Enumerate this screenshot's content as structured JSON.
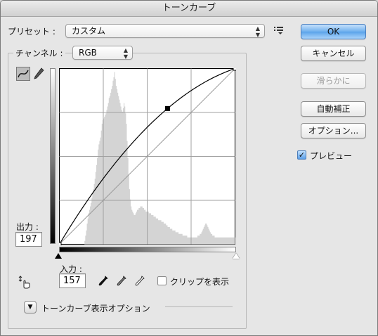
{
  "window": {
    "title": "トーンカーブ"
  },
  "preset": {
    "label": "プリセット :",
    "value": "カスタム",
    "menu_icon": "preset-options-icon"
  },
  "channel": {
    "label": "チャンネル :",
    "value": "RGB"
  },
  "tools": {
    "curve_tool_icon": "curve-point-icon",
    "pencil_tool_icon": "pencil-icon"
  },
  "output": {
    "label": "出力 :",
    "value": "197"
  },
  "input": {
    "label": "入力 :",
    "value": "157"
  },
  "eyedroppers": [
    "black-point-eyedropper-icon",
    "gray-point-eyedropper-icon",
    "white-point-eyedropper-icon"
  ],
  "clipping": {
    "label": "クリップを表示",
    "checked": false
  },
  "curve_display": {
    "label": "トーンカーブ表示オプション"
  },
  "buttons": {
    "ok": "OK",
    "cancel": "キャンセル",
    "smooth": "滑らかに",
    "auto": "自動補正",
    "options": "オプション..."
  },
  "preview": {
    "label": "プレビュー",
    "checked": true
  },
  "curve": {
    "points": [
      [
        0,
        0
      ],
      [
        157,
        197
      ],
      [
        255,
        255
      ]
    ],
    "grid_divisions": 4,
    "histogram": [
      0,
      0,
      0,
      0,
      0,
      0,
      0,
      0,
      0,
      0,
      0,
      0,
      0,
      0,
      0,
      0,
      0,
      0,
      0,
      0,
      0,
      0,
      0,
      0,
      0,
      0,
      0,
      0,
      0,
      0,
      0,
      0,
      0.02,
      0.05,
      0.08,
      0.12,
      0.15,
      0.18,
      0.2,
      0.22,
      0.24,
      0.27,
      0.3,
      0.32,
      0.35,
      0.38,
      0.42,
      0.46,
      0.5,
      0.55,
      0.58,
      0.6,
      0.62,
      0.66,
      0.7,
      0.72,
      0.73,
      0.74,
      0.75,
      0.76,
      0.78,
      0.8,
      0.82,
      0.85,
      0.86,
      0.88,
      0.9,
      0.92,
      0.95,
      0.97,
      1.0,
      0.96,
      0.92,
      0.9,
      0.88,
      0.86,
      0.84,
      0.82,
      0.8,
      0.78,
      0.77,
      0.79,
      0.82,
      0.8,
      0.76,
      0.7,
      0.6,
      0.5,
      0.4,
      0.32,
      0.26,
      0.22,
      0.2,
      0.19,
      0.18,
      0.17,
      0.17,
      0.18,
      0.19,
      0.2,
      0.2,
      0.21,
      0.21,
      0.22,
      0.22,
      0.22,
      0.21,
      0.21,
      0.2,
      0.2,
      0.19,
      0.19,
      0.19,
      0.19,
      0.18,
      0.18,
      0.18,
      0.17,
      0.17,
      0.17,
      0.16,
      0.16,
      0.16,
      0.15,
      0.15,
      0.15,
      0.14,
      0.14,
      0.14,
      0.14,
      0.13,
      0.13,
      0.13,
      0.12,
      0.12,
      0.12,
      0.11,
      0.11,
      0.1,
      0.1,
      0.1,
      0.09,
      0.09,
      0.09,
      0.08,
      0.08,
      0.08,
      0.08,
      0.07,
      0.07,
      0.07,
      0.07,
      0.06,
      0.06,
      0.06,
      0.06,
      0.06,
      0.05,
      0.05,
      0.05,
      0.05,
      0.05,
      0.05,
      0.04,
      0.04,
      0.04,
      0.04,
      0.04,
      0.04,
      0.04,
      0.04,
      0.04,
      0.04,
      0.04,
      0.04,
      0.04,
      0.05,
      0.05,
      0.05,
      0.06,
      0.06,
      0.07,
      0.08,
      0.09,
      0.1,
      0.11,
      0.12,
      0.12,
      0.11,
      0.1,
      0.09,
      0.08,
      0.07,
      0.06,
      0.06,
      0.05,
      0.05,
      0.05,
      0.04,
      0.04,
      0.04,
      0.04,
      0.04,
      0.04,
      0.04,
      0.04,
      0.04,
      0.04,
      0.04,
      0.04,
      0.04,
      0.04,
      0.04,
      0.04,
      0.04,
      0.04,
      0.04,
      0.04,
      0.04,
      0.04,
      0.04,
      0.04,
      0.04,
      0.04
    ]
  }
}
